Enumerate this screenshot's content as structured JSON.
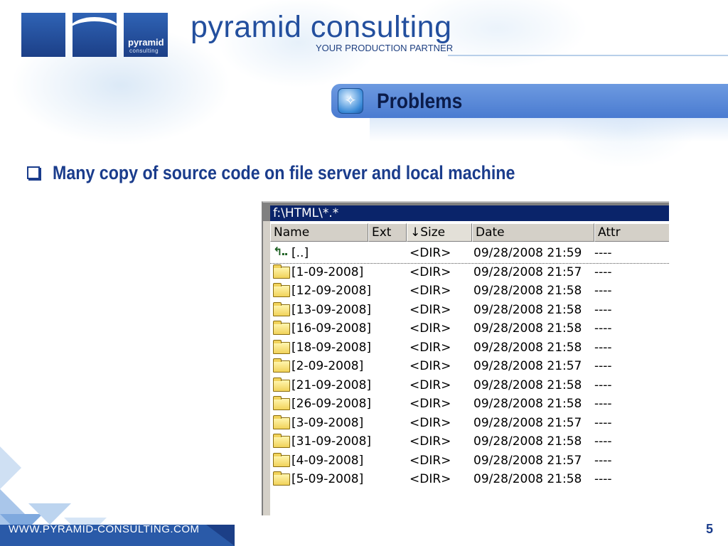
{
  "header": {
    "logo_text": "pyramid",
    "logo_subtext": "consulting",
    "brand_name": "pyramid consulting",
    "tagline": "YOUR PRODUCTION PARTNER"
  },
  "slide": {
    "title": "Problems",
    "title_icon": "compass-icon",
    "bullet": "Many copy of source code on file server and local machine",
    "page_number": "5"
  },
  "footer": {
    "url": "WWW.PYRAMID-CONSULTING.COM"
  },
  "file_manager": {
    "path": "f:\\HTML\\*.*",
    "columns": [
      "Name",
      "Ext",
      "↓Size",
      "Date",
      "Attr"
    ],
    "rows": [
      {
        "icon": "up-dir-icon",
        "name": "[..]",
        "size": "<DIR>",
        "date": "09/28/2008 21:59",
        "attr": "----"
      },
      {
        "icon": "folder-icon",
        "name": "[1-09-2008]",
        "size": "<DIR>",
        "date": "09/28/2008 21:57",
        "attr": "----"
      },
      {
        "icon": "folder-icon",
        "name": "[12-09-2008]",
        "size": "<DIR>",
        "date": "09/28/2008 21:58",
        "attr": "----"
      },
      {
        "icon": "folder-icon",
        "name": "[13-09-2008]",
        "size": "<DIR>",
        "date": "09/28/2008 21:58",
        "attr": "----"
      },
      {
        "icon": "folder-icon",
        "name": "[16-09-2008]",
        "size": "<DIR>",
        "date": "09/28/2008 21:58",
        "attr": "----"
      },
      {
        "icon": "folder-icon",
        "name": "[18-09-2008]",
        "size": "<DIR>",
        "date": "09/28/2008 21:58",
        "attr": "----"
      },
      {
        "icon": "folder-icon",
        "name": "[2-09-2008]",
        "size": "<DIR>",
        "date": "09/28/2008 21:57",
        "attr": "----"
      },
      {
        "icon": "folder-icon",
        "name": "[21-09-2008]",
        "size": "<DIR>",
        "date": "09/28/2008 21:58",
        "attr": "----"
      },
      {
        "icon": "folder-icon",
        "name": "[26-09-2008]",
        "size": "<DIR>",
        "date": "09/28/2008 21:58",
        "attr": "----"
      },
      {
        "icon": "folder-icon",
        "name": "[3-09-2008]",
        "size": "<DIR>",
        "date": "09/28/2008 21:57",
        "attr": "----"
      },
      {
        "icon": "folder-icon",
        "name": "[31-09-2008]",
        "size": "<DIR>",
        "date": "09/28/2008 21:58",
        "attr": "----"
      },
      {
        "icon": "folder-icon",
        "name": "[4-09-2008]",
        "size": "<DIR>",
        "date": "09/28/2008 21:57",
        "attr": "----"
      },
      {
        "icon": "folder-icon",
        "name": "[5-09-2008]",
        "size": "<DIR>",
        "date": "09/28/2008 21:58",
        "attr": "----"
      }
    ]
  },
  "colors": {
    "brand_blue": "#234f9e",
    "title_bar": "#5b89d8",
    "path_bar": "#0a246a"
  }
}
